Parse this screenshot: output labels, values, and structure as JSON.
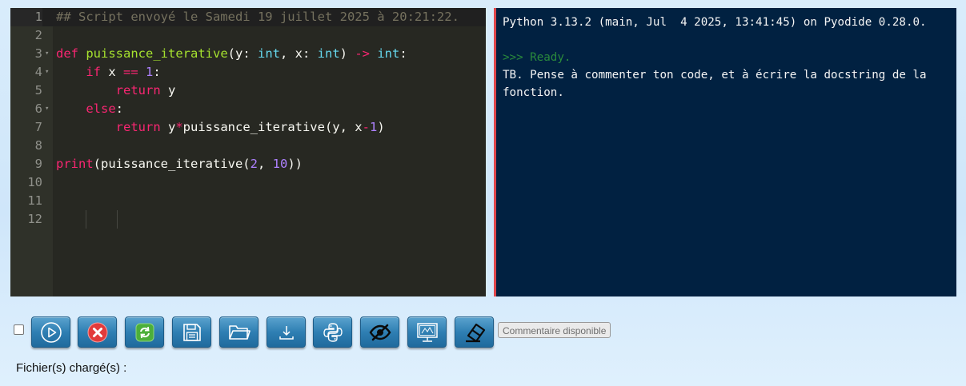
{
  "editor": {
    "lines": [
      {
        "n": "1",
        "html": "<span class=\"cm\">## Script envoyé le Samedi 19 juillet 2025 à 20:21:22.</span>"
      },
      {
        "n": "2",
        "html": ""
      },
      {
        "n": "3",
        "html": "<span class=\"kw\">def</span> <span class=\"fn\">puissance_iterative</span>(y: <span class=\"ty\">int</span>, x: <span class=\"ty\">int</span>) <span class=\"op\">-&gt;</span> <span class=\"ty\">int</span>:"
      },
      {
        "n": "4",
        "html": "    <span class=\"kw\">if</span> x <span class=\"op\">==</span> <span class=\"num\">1</span>:"
      },
      {
        "n": "5",
        "html": "        <span class=\"kw\">return</span> y"
      },
      {
        "n": "6",
        "html": "    <span class=\"kw\">else</span>:"
      },
      {
        "n": "7",
        "html": "        <span class=\"kw\">return</span> y<span class=\"op\">*</span>puissance_iterative(y, x<span class=\"op\">-</span><span class=\"num\">1</span>)"
      },
      {
        "n": "8",
        "html": ""
      },
      {
        "n": "9",
        "html": "<span class=\"kw\">print</span>(puissance_iterative(<span class=\"num\">2</span>, <span class=\"num\">10</span>))"
      },
      {
        "n": "10",
        "html": ""
      },
      {
        "n": "11",
        "html": ""
      },
      {
        "n": "12",
        "html": ""
      }
    ],
    "fold_lines": [
      "3",
      "4",
      "6"
    ],
    "active_line": "1"
  },
  "console": {
    "banner": "Python 3.13.2 (main, Jul  4 2025, 13:41:45) on Pyodide 0.28.0.",
    "ready": ">>> Ready.",
    "message": "TB. Pense à commenter ton code, et à écrire la docstring de la fonction."
  },
  "toolbar": {
    "buttons": [
      {
        "name": "run-button",
        "icon": "play-circle-icon"
      },
      {
        "name": "stop-button",
        "icon": "red-x-icon"
      },
      {
        "name": "reload-button",
        "icon": "refresh-icon"
      },
      {
        "name": "save-button",
        "icon": "floppy-disk-icon"
      },
      {
        "name": "open-button",
        "icon": "folder-icon"
      },
      {
        "name": "download-button",
        "icon": "download-icon"
      },
      {
        "name": "python-button",
        "icon": "python-logo-icon"
      },
      {
        "name": "hide-button",
        "icon": "eye-slash-icon"
      },
      {
        "name": "display-button",
        "icon": "monitor-icon"
      },
      {
        "name": "clear-button",
        "icon": "eraser-icon"
      }
    ],
    "comment_badge": "Commentaire disponible"
  },
  "files": {
    "label": "Fichier(s) chargé(s) :"
  }
}
